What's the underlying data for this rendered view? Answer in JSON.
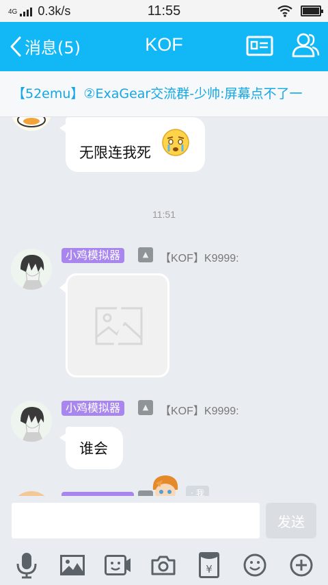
{
  "status_bar": {
    "network": "4G",
    "speed": "0.3k/s",
    "time": "11:55",
    "battery_level": 1.0
  },
  "title_bar": {
    "back_label": "消息(5)",
    "title": "KOF"
  },
  "notice": {
    "text": "【52emu】②ExaGear交流群-少帅:屏幕点不了一"
  },
  "messages": [
    {
      "text": "无限连我死",
      "emoji": "crying-face-icon"
    },
    {
      "time": "11:51"
    },
    {
      "tag": "小鸡模拟器",
      "sender": "【KOF】K9999:",
      "image": "image-placeholder-icon"
    },
    {
      "tag": "小鸡模拟器",
      "sender": "【KOF】K9999:",
      "text": "谁会"
    },
    {
      "self_label": "我"
    }
  ],
  "input": {
    "value": "",
    "placeholder": "",
    "send_label": "发送"
  },
  "toolbar": [
    "mic-icon",
    "image-icon",
    "video-icon",
    "camera-icon",
    "red-packet-icon",
    "emoji-icon",
    "plus-icon"
  ],
  "colors": {
    "accent": "#12b7f5",
    "tag": "#a886ee",
    "notice_text": "#12a7e6",
    "background": "#e9edf1"
  }
}
